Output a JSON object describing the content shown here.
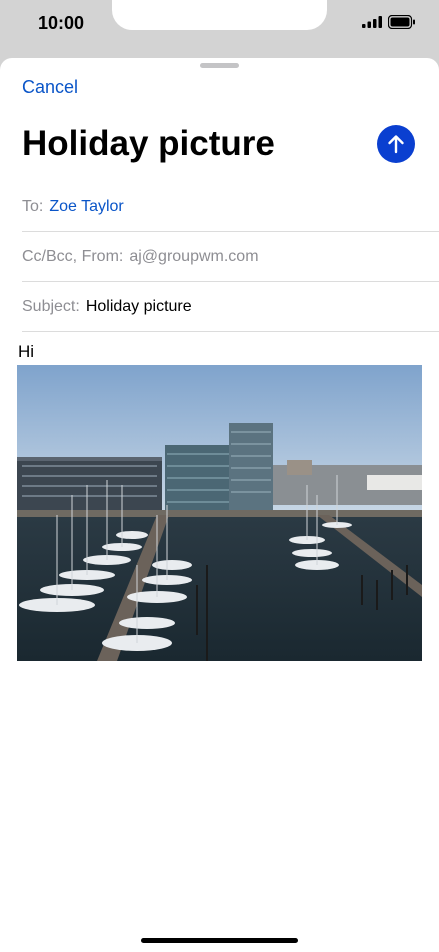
{
  "status_bar": {
    "time": "10:00",
    "signal_icon": "cellular-signal-icon",
    "battery_icon": "battery-full-icon"
  },
  "compose": {
    "cancel_label": "Cancel",
    "title": "Holiday picture",
    "send_icon": "arrow-up-icon",
    "accent_color": "#0a3fd0",
    "link_color": "#0a55c8"
  },
  "fields": {
    "to_label": "To:",
    "to_value": "Zoe Taylor",
    "ccbcc_label": "Cc/Bcc, From:",
    "ccbcc_value": "aj@groupwm.com",
    "subject_label": "Subject:",
    "subject_value": "Holiday picture"
  },
  "body": {
    "text": "Hi",
    "attachment": "photo of marina with boats and buildings"
  }
}
